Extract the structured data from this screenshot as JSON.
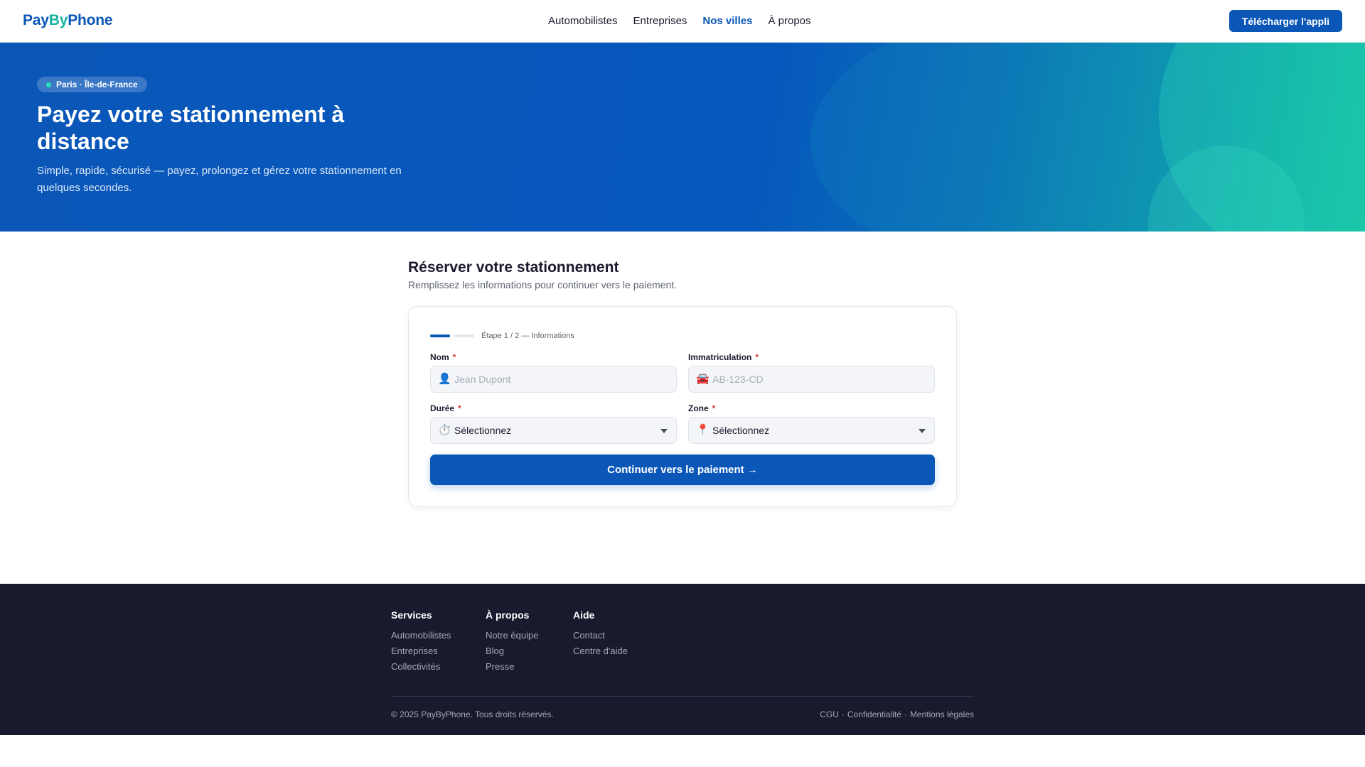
{
  "header": {
    "logo": {
      "part1": "Pay",
      "part2": "By",
      "part3": "Phone"
    },
    "nav": [
      {
        "label": "Automobilistes"
      },
      {
        "label": "Entreprises"
      },
      {
        "label": "Nos villes",
        "active": true
      },
      {
        "label": "À propos"
      }
    ],
    "download_label": "Télécharger l'appli"
  },
  "hero": {
    "badge": "Paris · Île-de-France",
    "title": "Payez votre stationnement à distance",
    "subtitle": "Simple, rapide, sécurisé — payez, prolongez et gérez votre stationnement en quelques secondes."
  },
  "form": {
    "title": "Réserver votre stationnement",
    "subtitle": "Remplissez les informations pour continuer vers le paiement.",
    "step_label": "Étape 1 / 2 — Informations",
    "step_current": 1,
    "step_total": 2,
    "required_mark": "*",
    "fields": {
      "nom": {
        "label": "Nom",
        "placeholder": "Jean Dupont",
        "icon": "person-icon"
      },
      "immatriculation": {
        "label": "Immatriculation",
        "placeholder": "AB-123-CD",
        "icon": "car-icon"
      },
      "duree": {
        "label": "Durée",
        "value": "Sélectionnez",
        "icon": "stopwatch-icon"
      },
      "zone": {
        "label": "Zone",
        "value": "Sélectionnez",
        "icon": "pin-icon"
      }
    },
    "submit_label": "Continuer vers le paiement →"
  },
  "footer": {
    "columns": [
      {
        "title": "Services",
        "links": [
          "Automobilistes",
          "Entreprises",
          "Collectivités"
        ]
      },
      {
        "title": "À propos",
        "links": [
          "Notre équipe",
          "Blog",
          "Presse"
        ]
      },
      {
        "title": "Aide",
        "links": [
          "Contact",
          "Centre d'aide"
        ]
      }
    ],
    "copyright": "© 2025 PayByPhone. Tous droits réservés.",
    "legal": [
      "CGU",
      "Confidentialité",
      "Mentions légales"
    ],
    "legal_separator": "·"
  },
  "colors": {
    "brand": "#0a57b8",
    "accent": "#12b3a0",
    "footer_bg": "#1a1a2e",
    "required": "#d93a3a"
  }
}
